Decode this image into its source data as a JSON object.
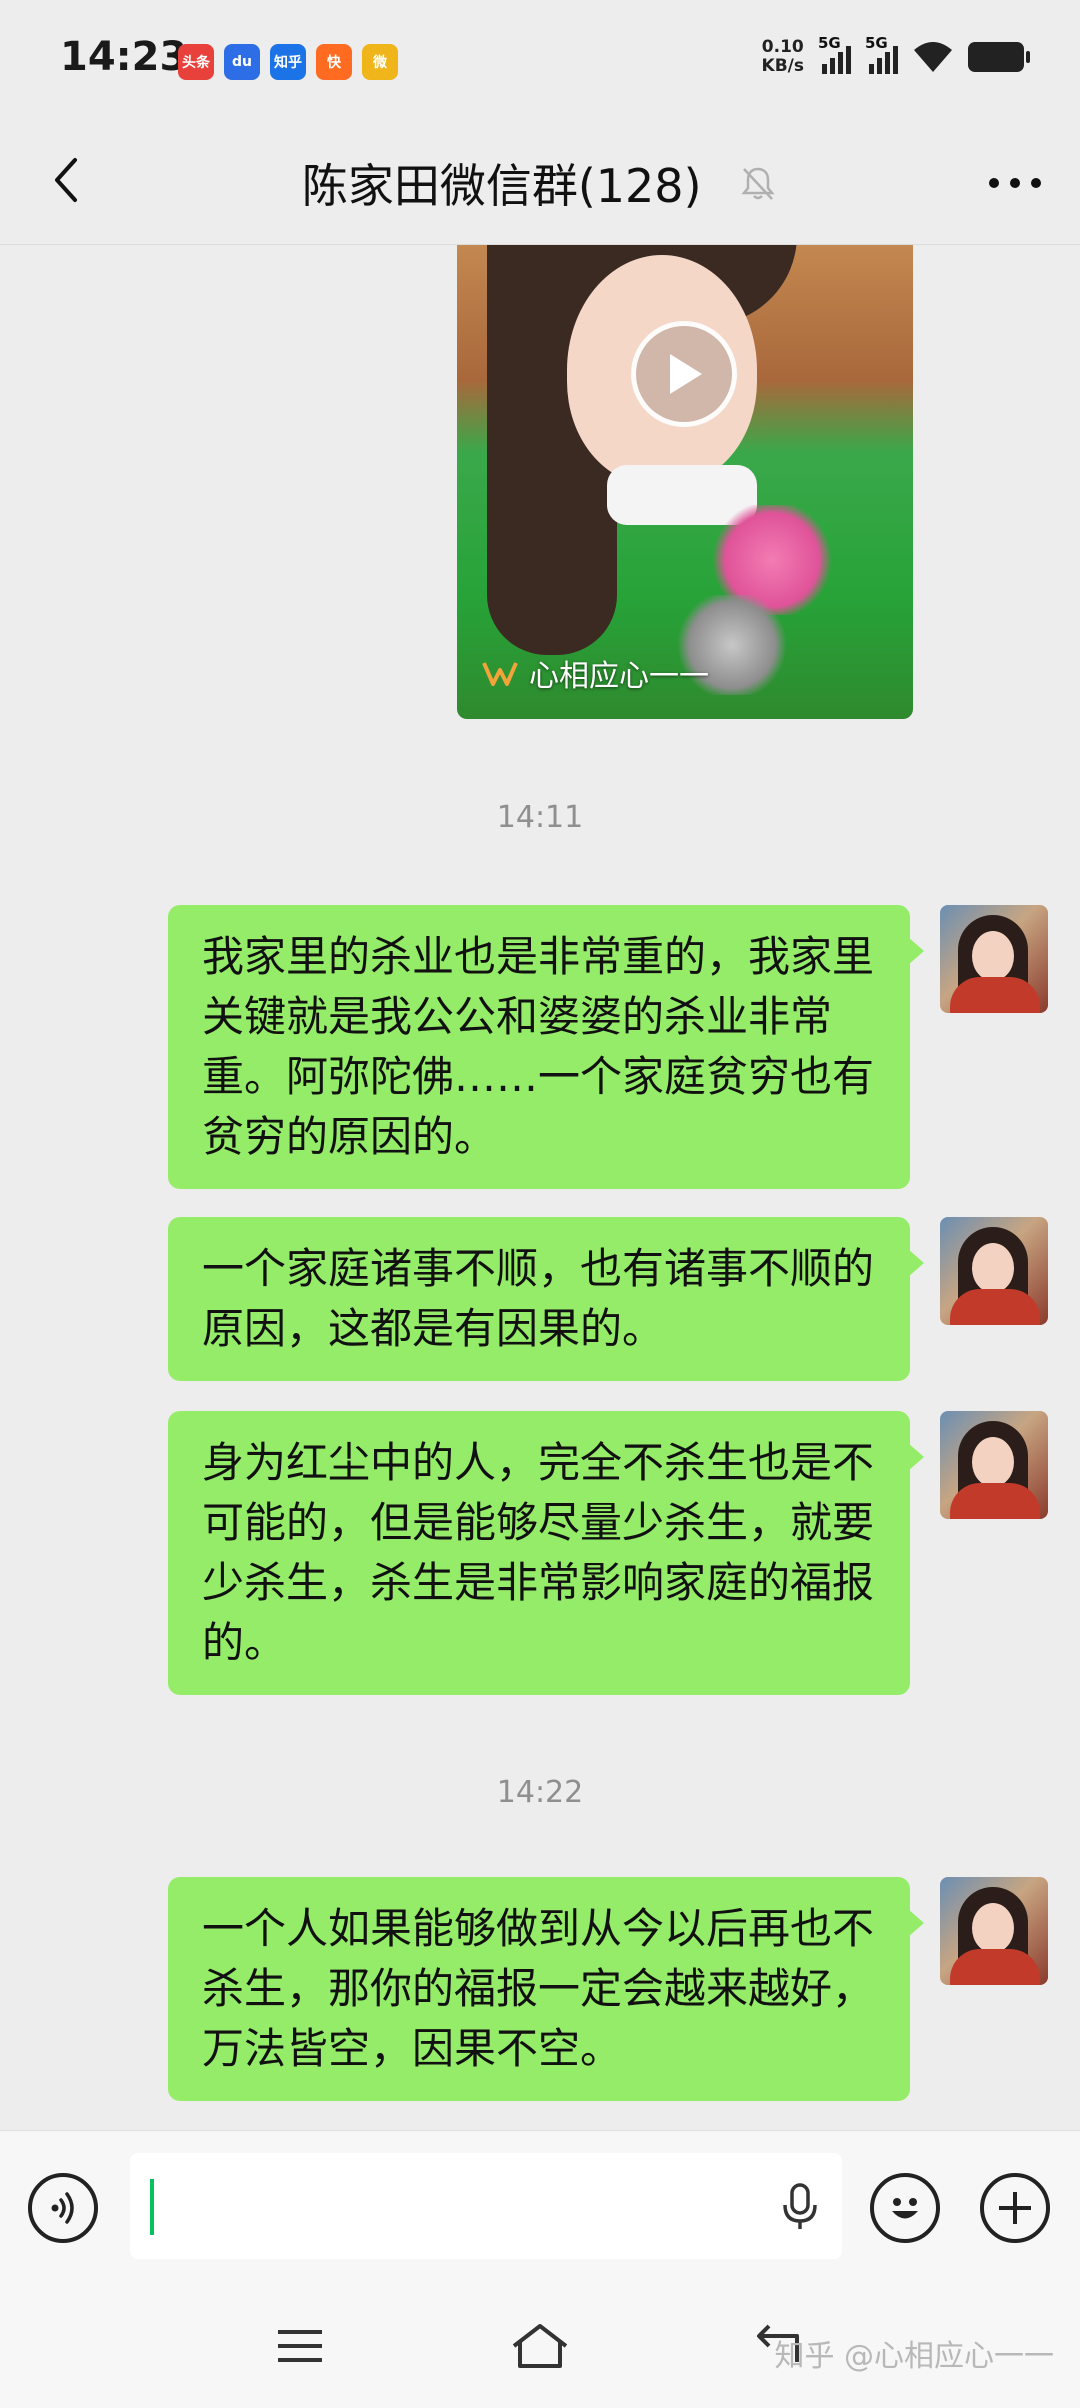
{
  "status_bar": {
    "time": "14:23",
    "apps": [
      {
        "name": "toutiao",
        "label": "头条",
        "color": "#e8403a"
      },
      {
        "name": "baidu",
        "label": "du",
        "color": "#2d6ee6"
      },
      {
        "name": "zhihu",
        "label": "知乎",
        "color": "#1c73e8"
      },
      {
        "name": "kuaishou",
        "label": "快",
        "color": "#ff6b21"
      },
      {
        "name": "weibo",
        "label": "微",
        "color": "#f1b51c"
      }
    ],
    "net_speed_value": "0.10",
    "net_speed_unit": "KB/s",
    "sim1_label": "5G",
    "sim2_label": "5G"
  },
  "header": {
    "title": "陈家田微信群(128)"
  },
  "video_card": {
    "caption": "心相应心一一"
  },
  "messages": [
    {
      "type": "timestamp",
      "text": "14:11"
    },
    {
      "type": "text",
      "text": "我家里的杀业也是非常重的，我家里关键就是我公公和婆婆的杀业非常重。阿弥陀佛……一个家庭贫穷也有贫穷的原因的。"
    },
    {
      "type": "text",
      "text": "一个家庭诸事不顺，也有诸事不顺的原因，这都是有因果的。"
    },
    {
      "type": "text",
      "text": "身为红尘中的人，完全不杀生也是不可能的，但是能够尽量少杀生，就要少杀生，杀生是非常影响家庭的福报的。"
    },
    {
      "type": "timestamp",
      "text": "14:22"
    },
    {
      "type": "text",
      "text": "一个人如果能够做到从今以后再也不杀生，那你的福报一定会越来越好，万法皆空，因果不空。"
    }
  ],
  "input": {
    "value": ""
  },
  "watermark": "知乎 @心相应心一一",
  "colors": {
    "bubble": "#95ec69",
    "background": "#ededed",
    "caret": "#07c160"
  }
}
